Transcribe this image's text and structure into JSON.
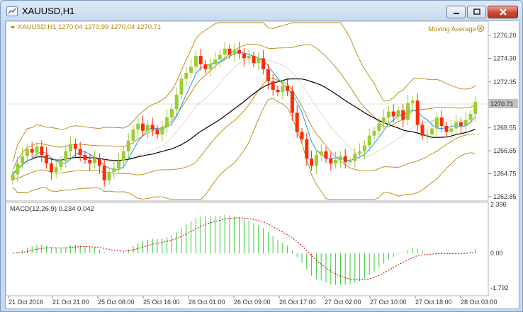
{
  "window": {
    "title": "XAUUSD,H1",
    "frame_color": "#7d9dc4"
  },
  "icons": {
    "app": "chart-window-icon",
    "minimize": "minimize-icon",
    "maximize": "maximize-icon",
    "close": "close-icon",
    "collapse": "triangle-down-icon",
    "indicator_close": "circle-close-icon"
  },
  "header": {
    "symbol_line": "XAUUSD,H1  1270.04 1270.99 1270.04 1270.71",
    "indicator_name": "Moving Average"
  },
  "price_axis": {
    "labels": [
      "1276.20",
      "1274.30",
      "1272.35",
      "1270.71",
      "1268.55",
      "1266.65",
      "1264.75",
      "1262.85"
    ],
    "current_price": "1270.71"
  },
  "macd": {
    "label": "MACD(12,26,9) 0.234 0.042",
    "axis_labels": [
      "2.396",
      "0.00",
      "-1.792"
    ]
  },
  "time_axis": {
    "labels": [
      "21 Oct 2016",
      "21 Oct 21:00",
      "25 Oct 08:00",
      "25 Oct 16:00",
      "26 Oct 01:00",
      "26 Oct 09:00",
      "26 Oct 17:00",
      "27 Oct 02:00",
      "27 Oct 10:00",
      "27 Oct 18:00",
      "28 Oct 03:00"
    ]
  },
  "colors": {
    "bull": "#9acd32",
    "bear": "#ff2a00",
    "bands": "#b8860b",
    "fast_ma": "#1e90ff",
    "slow_ma": "#000000",
    "macd_hist": "#32cd32",
    "macd_signal": "#cc0000",
    "grid": "#c0c0c0",
    "axis_text": "#b8860b"
  },
  "chart_data": {
    "type": "candlestick",
    "symbol": "XAUUSD",
    "timeframe": "H1",
    "ohlc": [
      1270.04,
      1270.99,
      1270.04,
      1270.71
    ],
    "ylim": [
      1262.85,
      1276.99
    ],
    "closes": [
      1264.7,
      1265.6,
      1266.2,
      1266.8,
      1266.5,
      1267.0,
      1266.3,
      1265.6,
      1264.9,
      1265.3,
      1265.8,
      1266.6,
      1267.2,
      1266.8,
      1266.3,
      1265.9,
      1265.6,
      1266.0,
      1265.4,
      1264.2,
      1264.9,
      1265.2,
      1265.8,
      1266.6,
      1267.5,
      1268.4,
      1268.9,
      1268.3,
      1268.8,
      1268.4,
      1268.0,
      1268.6,
      1269.4,
      1270.1,
      1271.3,
      1272.6,
      1273.1,
      1273.6,
      1274.5,
      1273.8,
      1273.4,
      1273.8,
      1274.2,
      1274.6,
      1275.1,
      1274.6,
      1275.0,
      1274.7,
      1274.3,
      1274.5,
      1273.9,
      1274.3,
      1273.4,
      1272.4,
      1271.7,
      1271.5,
      1272.0,
      1271.6,
      1269.8,
      1268.2,
      1267.6,
      1266.0,
      1265.4,
      1266.3,
      1266.6,
      1266.0,
      1265.6,
      1265.9,
      1266.2,
      1265.7,
      1265.8,
      1266.4,
      1266.6,
      1267.1,
      1267.9,
      1268.3,
      1268.9,
      1269.4,
      1269.9,
      1269.5,
      1270.0,
      1269.2,
      1270.6,
      1270.8,
      1268.8,
      1267.9,
      1268.0,
      1268.5,
      1269.4,
      1268.7,
      1268.2,
      1268.5,
      1269.0,
      1268.7,
      1269.2,
      1269.7,
      1270.7
    ],
    "series": [
      {
        "name": "Moving Average",
        "type": "line"
      },
      {
        "name": "MACD(12,26,9)",
        "values": [
          0.234,
          0.042
        ]
      }
    ]
  }
}
